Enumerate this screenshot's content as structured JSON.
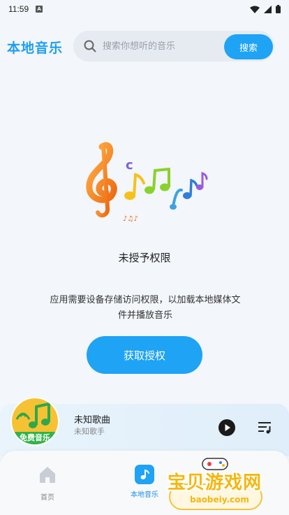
{
  "status_bar": {
    "time": "11:59",
    "notification_letter": "A",
    "icons": [
      "wifi-icon",
      "signal-icon",
      "battery-icon"
    ]
  },
  "header": {
    "title": "本地音乐",
    "search_placeholder": "搜索你想听的音乐",
    "search_button": "搜索"
  },
  "permission": {
    "title": "未授予权限",
    "description": "应用需要设备存储访问权限，以加载本地媒体文件并播放音乐",
    "grant_button": "获取授权"
  },
  "player": {
    "album_label": "免费音乐",
    "song_title": "未知歌曲",
    "artist": "未知歌手"
  },
  "bottom_nav": {
    "items": [
      {
        "label": "首页",
        "icon": "home-icon",
        "active": false
      },
      {
        "label": "本地音乐",
        "icon": "music-note-icon",
        "active": true
      }
    ]
  },
  "watermark": {
    "text": "宝贝游戏网",
    "url": "baobeiy.com"
  },
  "colors": {
    "accent": "#1ea3f5",
    "title": "#1e9ef0",
    "background": "#f3f6fa"
  }
}
